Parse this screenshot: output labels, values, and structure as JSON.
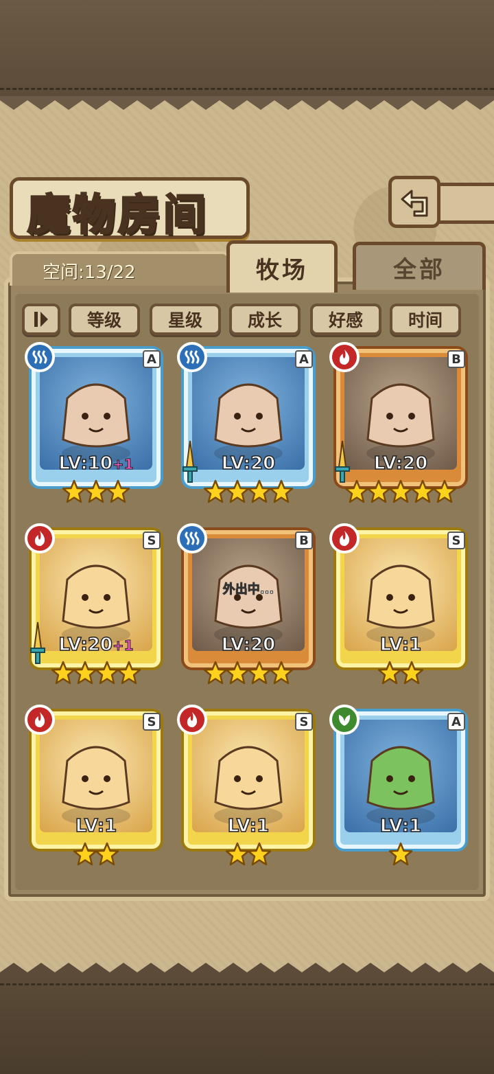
{
  "header": {
    "title": "魔物房间",
    "back_icon": "return-arrow-icon"
  },
  "space": {
    "label": "空间:13/22"
  },
  "tabs": [
    {
      "label": "牧场",
      "active": true
    },
    {
      "label": "全部",
      "active": false
    }
  ],
  "filters": {
    "toggle_icon": "sort-toggle-icon",
    "buttons": [
      "等级",
      "星级",
      "成长",
      "好感",
      "时间"
    ]
  },
  "monsters": [
    {
      "element": "water",
      "rank": "A",
      "level": "LV:10",
      "bonus": "+1",
      "stars": 3,
      "frame": "blue",
      "weapon": false,
      "status": ""
    },
    {
      "element": "water",
      "rank": "A",
      "level": "LV:20",
      "bonus": "",
      "stars": 4,
      "frame": "blue",
      "weapon": true,
      "status": ""
    },
    {
      "element": "fire",
      "rank": "B",
      "level": "LV:20",
      "bonus": "",
      "stars": 5,
      "frame": "orange",
      "weapon": true,
      "status": ""
    },
    {
      "element": "fire",
      "rank": "S",
      "level": "LV:20",
      "bonus": "+1",
      "stars": 4,
      "frame": "gold",
      "weapon": true,
      "status": ""
    },
    {
      "element": "water",
      "rank": "B",
      "level": "LV:20",
      "bonus": "",
      "stars": 4,
      "frame": "orange",
      "weapon": false,
      "status": "外出中..."
    },
    {
      "element": "fire",
      "rank": "S",
      "level": "LV:1",
      "bonus": "",
      "stars": 2,
      "frame": "gold",
      "weapon": false,
      "status": ""
    },
    {
      "element": "fire",
      "rank": "S",
      "level": "LV:1",
      "bonus": "",
      "stars": 2,
      "frame": "gold",
      "weapon": false,
      "status": ""
    },
    {
      "element": "fire",
      "rank": "S",
      "level": "LV:1",
      "bonus": "",
      "stars": 2,
      "frame": "gold",
      "weapon": false,
      "status": ""
    },
    {
      "element": "grass",
      "rank": "A",
      "level": "LV:1",
      "bonus": "",
      "stars": 1,
      "frame": "blue",
      "weapon": false,
      "status": ""
    }
  ]
}
